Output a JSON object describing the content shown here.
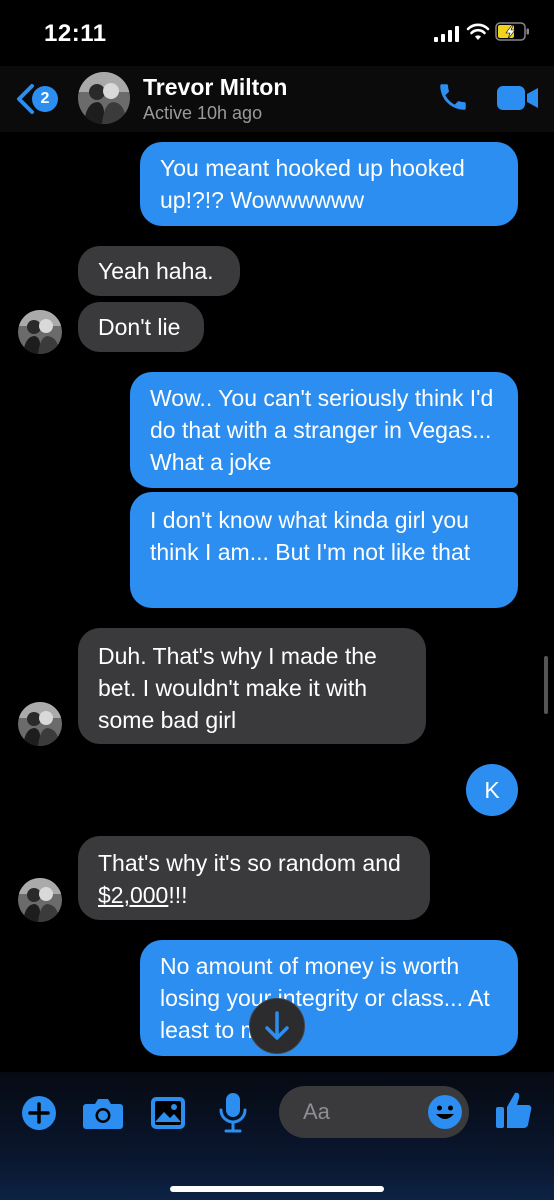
{
  "status": {
    "time": "12:11"
  },
  "header": {
    "back_count": "2",
    "name": "Trevor Milton",
    "status": "Active 10h ago"
  },
  "messages": [
    {
      "side": "out",
      "text": "You meant hooked up hooked up!?!? Wowwwwww"
    },
    {
      "side": "in",
      "text": "Yeah haha."
    },
    {
      "side": "in",
      "text": "Don't lie"
    },
    {
      "side": "out",
      "text": "Wow.. You can't seriously think I'd do that with a stranger in Vegas... What a joke"
    },
    {
      "side": "out",
      "text": "I don't know what kinda girl you think I am... But I'm not like that"
    },
    {
      "side": "in",
      "text": "Duh. That's why I made the bet. I wouldn't make it with some bad girl"
    },
    {
      "side": "out",
      "text": "K"
    },
    {
      "side": "in",
      "text_before": "That's why it's so random and ",
      "link": "$2,000",
      "text_after": "!!!"
    },
    {
      "side": "out",
      "text": "No amount of money is worth losing your integrity or class... At least to me."
    }
  ],
  "composer": {
    "placeholder": "Aa"
  },
  "colors": {
    "accent": "#2b8ef0",
    "incoming": "#3a3a3c",
    "background": "#000000"
  },
  "icons": [
    "back-chevron-icon",
    "phone-icon",
    "video-camera-icon",
    "plus-icon",
    "camera-icon",
    "image-icon",
    "microphone-icon",
    "emoji-icon",
    "thumbs-up-icon",
    "arrow-down-icon"
  ]
}
